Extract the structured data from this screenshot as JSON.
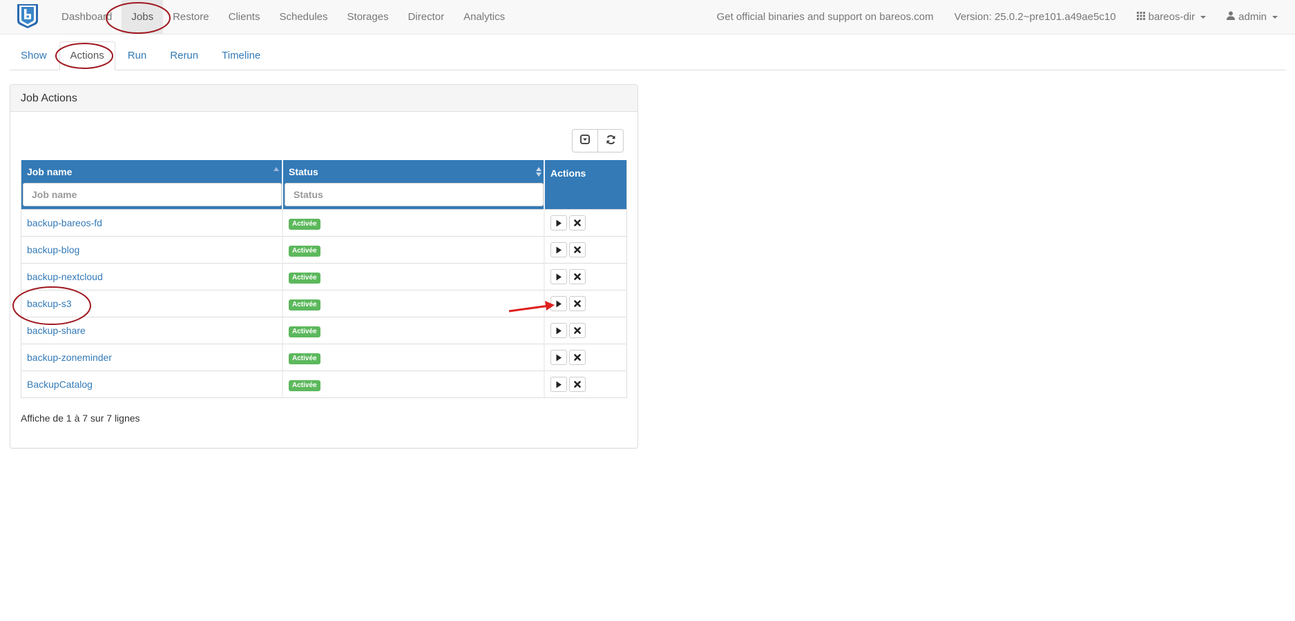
{
  "navbar": {
    "items": [
      {
        "label": "Dashboard"
      },
      {
        "label": "Jobs"
      },
      {
        "label": "Restore"
      },
      {
        "label": "Clients"
      },
      {
        "label": "Schedules"
      },
      {
        "label": "Storages"
      },
      {
        "label": "Director"
      },
      {
        "label": "Analytics"
      }
    ],
    "support_text": "Get official binaries and support on bareos.com",
    "version_text": "Version: 25.0.2~pre101.a49ae5c10",
    "director_label": "bareos-dir",
    "user_label": "admin",
    "brand_color": "#337ab7"
  },
  "tabs": [
    {
      "label": "Show"
    },
    {
      "label": "Actions"
    },
    {
      "label": "Run"
    },
    {
      "label": "Rerun"
    },
    {
      "label": "Timeline"
    }
  ],
  "panel": {
    "title": "Job Actions",
    "columns": {
      "job_name": "Job name",
      "status": "Status",
      "actions": "Actions"
    },
    "filters": {
      "job_name_placeholder": "Job name",
      "status_placeholder": "Status"
    },
    "rows": [
      {
        "name": "backup-bareos-fd",
        "status": "Activée"
      },
      {
        "name": "backup-blog",
        "status": "Activée"
      },
      {
        "name": "backup-nextcloud",
        "status": "Activée"
      },
      {
        "name": "backup-s3",
        "status": "Activée"
      },
      {
        "name": "backup-share",
        "status": "Activée"
      },
      {
        "name": "backup-zoneminder",
        "status": "Activée"
      },
      {
        "name": "BackupCatalog",
        "status": "Activée"
      }
    ],
    "info_text": "Affiche de 1 à 7 sur 7 lignes"
  },
  "colors": {
    "table_header": "#337ab7",
    "status_badge": "#5cb85c",
    "annotation": "#a01820",
    "arrow": "#e02020"
  }
}
